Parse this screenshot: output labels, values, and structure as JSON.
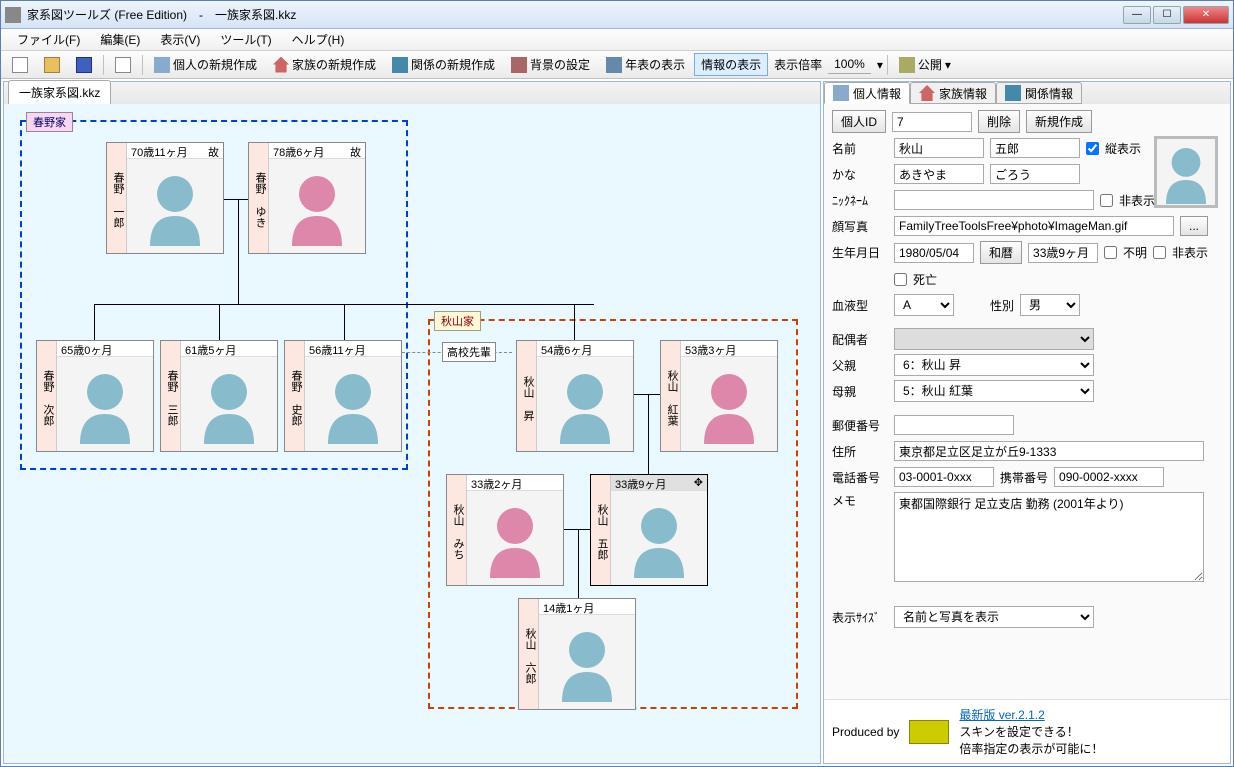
{
  "window": {
    "title": "家系図ツールズ (Free Edition)　-　一族家系図.kkz"
  },
  "menu": {
    "file": "ファイル(F)",
    "edit": "編集(E)",
    "view": "表示(V)",
    "tool": "ツール(T)",
    "help": "ヘルプ(H)"
  },
  "toolbar": {
    "new_person": "個人の新規作成",
    "new_family": "家族の新規作成",
    "new_relation": "関係の新規作成",
    "bg_setting": "背景の設定",
    "show_timeline": "年表の表示",
    "show_info": "情報の表示",
    "zoom_label": "表示倍率",
    "zoom_value": "100%",
    "publish": "公開"
  },
  "tab": {
    "name": "一族家系図.kkz"
  },
  "families": {
    "haruno": "春野家",
    "akiyama": "秋山家",
    "rel_hs": "高校先輩"
  },
  "persons": {
    "p1": {
      "name": "春野 一郎",
      "age": "70歳11ヶ月",
      "dec": "故",
      "sex": "m"
    },
    "p2": {
      "name": "春野 ゆき",
      "age": "78歳6ヶ月",
      "dec": "故",
      "sex": "f"
    },
    "p3": {
      "name": "春野 次郎",
      "age": "65歳0ヶ月",
      "dec": "",
      "sex": "m"
    },
    "p4": {
      "name": "春野 三郎",
      "age": "61歳5ヶ月",
      "dec": "",
      "sex": "m"
    },
    "p5": {
      "name": "春野 史郎",
      "age": "56歳11ヶ月",
      "dec": "",
      "sex": "m"
    },
    "p6": {
      "name": "秋山 昇",
      "age": "54歳6ヶ月",
      "dec": "",
      "sex": "m"
    },
    "p7": {
      "name": "秋山 紅葉",
      "age": "53歳3ヶ月",
      "dec": "",
      "sex": "f"
    },
    "p8": {
      "name": "秋山 みち",
      "age": "33歳2ヶ月",
      "dec": "",
      "sex": "f"
    },
    "p9": {
      "name": "秋山 五郎",
      "age": "33歳9ヶ月",
      "dec": "",
      "sex": "m"
    },
    "p10": {
      "name": "秋山 六郎",
      "age": "14歳1ヶ月",
      "dec": "",
      "sex": "m"
    }
  },
  "info": {
    "tab_person": "個人情報",
    "tab_family": "家族情報",
    "tab_relation": "関係情報",
    "id_label": "個人ID",
    "id_value": "7",
    "delete": "削除",
    "create": "新規作成",
    "name_label": "名前",
    "surname": "秋山",
    "given": "五郎",
    "vert_label": "縦表示",
    "kana_label": "かな",
    "kana_surname": "あきやま",
    "kana_given": "ごろう",
    "nick_label": "ﾆｯｸﾈｰﾑ",
    "hide_label": "非表示",
    "photo_label": "顔写真",
    "photo_path": "FamilyTreeToolsFree¥photo¥ImageMan.gif",
    "bday_label": "生年月日",
    "bday_value": "1980/05/04",
    "wareki": "和暦",
    "age_calc": "33歳9ヶ月",
    "unknown_label": "不明",
    "death_label": "死亡",
    "blood_label": "血液型",
    "blood_value": "A",
    "sex_label": "性別",
    "sex_value": "男",
    "spouse_label": "配偶者",
    "father_label": "父親",
    "father_value": "6：秋山 昇",
    "mother_label": "母親",
    "mother_value": "5：秋山 紅葉",
    "zip_label": "郵便番号",
    "addr_label": "住所",
    "addr_value": "東京都足立区足立が丘9-1333",
    "tel_label": "電話番号",
    "tel_value": "03-0001-0xxx",
    "mobile_label": "携帯番号",
    "mobile_value": "090-0002-xxxx",
    "memo_label": "メモ",
    "memo_value": "東都国際銀行 足立支店 勤務 (2001年より)",
    "size_label": "表示ｻｲｽﾞ",
    "size_value": "名前と写真を表示"
  },
  "footer": {
    "produced": "Produced by",
    "version_link": "最新版 ver.2.1.2",
    "msg1": "スキンを設定できる！",
    "msg2": "倍率指定の表示が可能に！"
  }
}
